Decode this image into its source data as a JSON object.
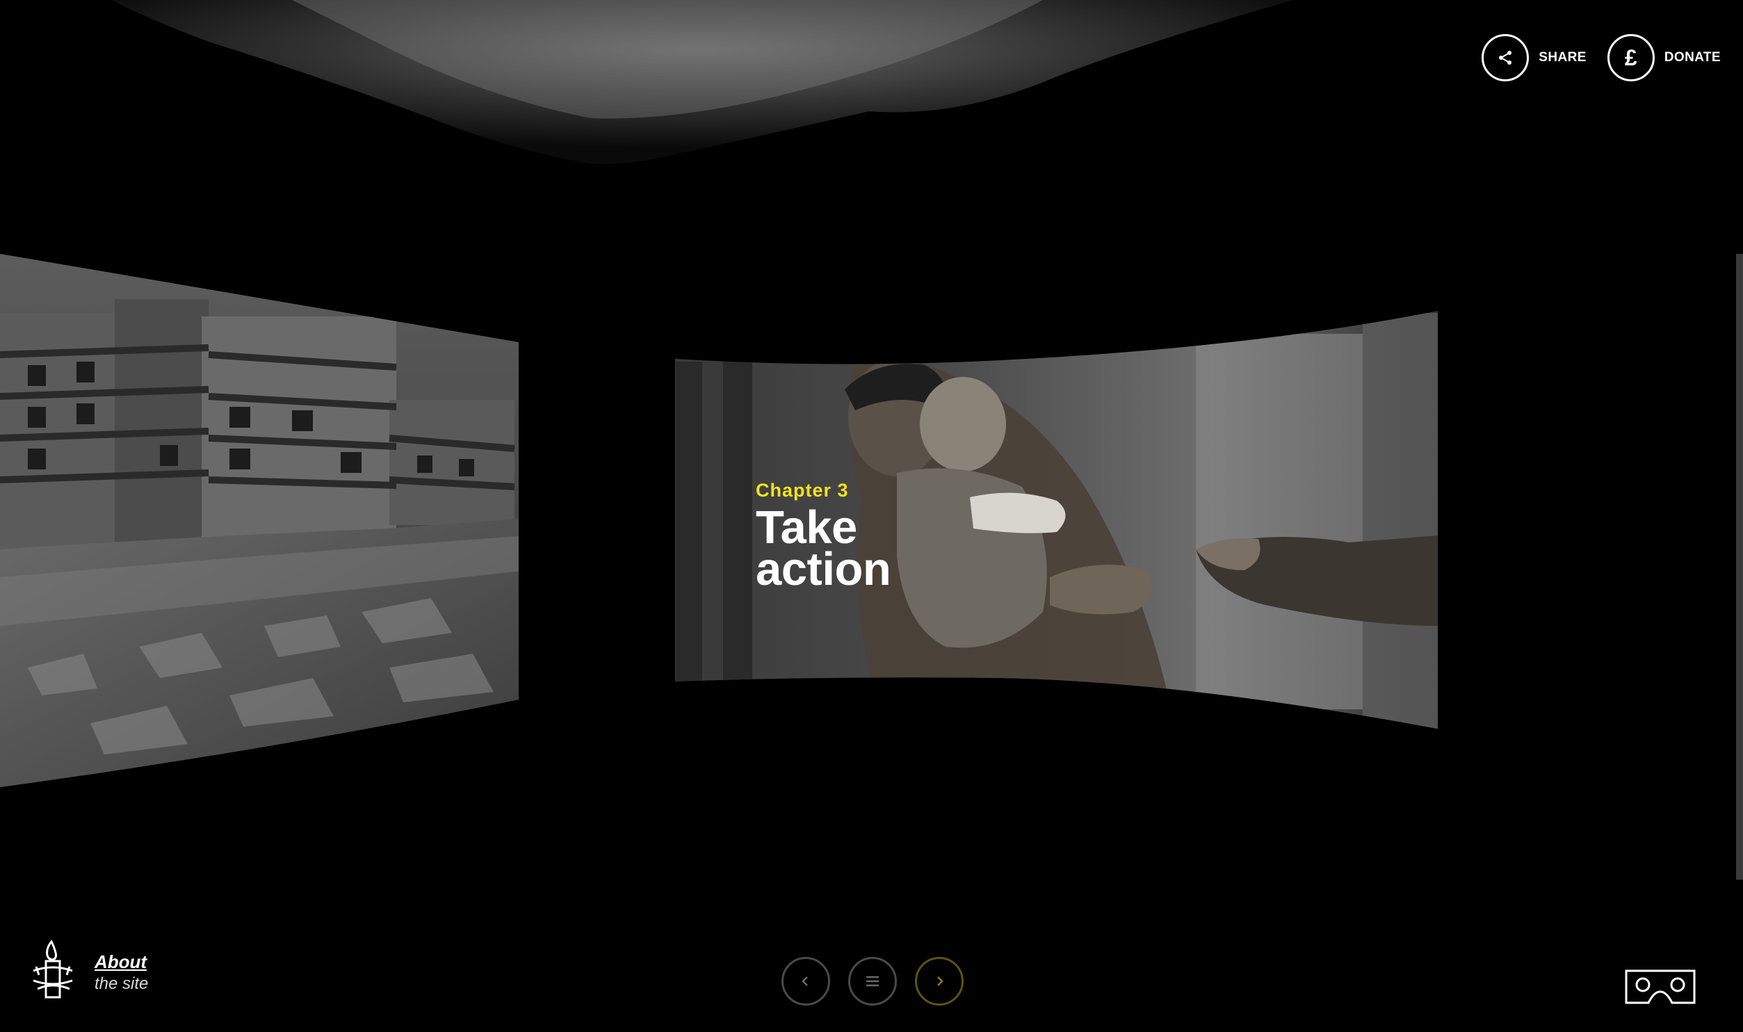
{
  "header": {
    "share_label": "SHARE",
    "donate_label": "DONATE",
    "donate_symbol": "£"
  },
  "chapter": {
    "number_label": "Chapter 3",
    "title_line1": "Take",
    "title_line2": "action"
  },
  "about": {
    "link_label": "About",
    "sub_label": "the site"
  },
  "navigation": {
    "prev_icon": "chevron-left-icon",
    "menu_icon": "menu-icon",
    "next_icon": "chevron-right-icon"
  },
  "vr": {
    "icon": "vr-headset-icon"
  },
  "colors": {
    "accent_yellow": "#f4e21e",
    "background": "#000000",
    "nav_border": "#4a4a4a",
    "next_border": "#5d5313"
  }
}
